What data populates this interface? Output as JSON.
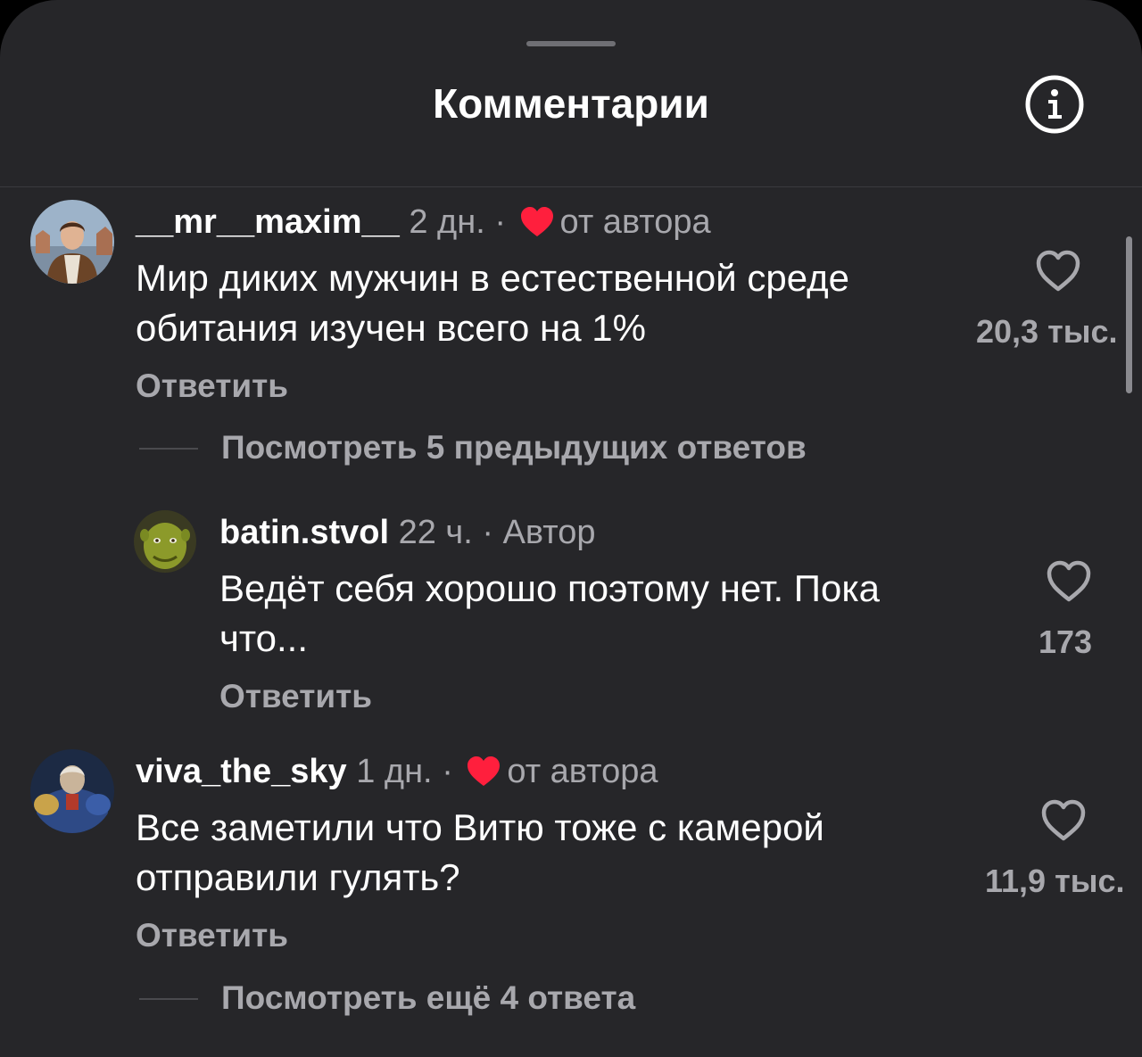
{
  "header": {
    "title": "Комментарии"
  },
  "colors": {
    "background": "#262629",
    "text": "#ffffff",
    "secondary": "#a8a8ad",
    "heart_red": "#ff1f3d"
  },
  "comments": [
    {
      "username": "__mr__maxim__",
      "time": "2 дн.",
      "separator": "·",
      "badge": "от автора",
      "badge_icon": "red-heart-icon",
      "text_lines": [
        "Мир диких мужчин в естественной среде",
        "обитания изучен всего на 1%"
      ],
      "reply_label": "Ответить",
      "likes": "20,3 тыс.",
      "view_replies": "Посмотреть 5 предыдущих ответов"
    },
    {
      "username": "batin.stvol",
      "time": "22 ч.",
      "separator": "·",
      "badge": "Автор",
      "text_lines": [
        "Ведёт себя хорошо поэтому нет. Пока",
        "что..."
      ],
      "reply_label": "Ответить",
      "likes": "173"
    },
    {
      "username": "viva_the_sky",
      "time": "1 дн.",
      "separator": "·",
      "badge": "от автора",
      "badge_icon": "red-heart-icon",
      "text_lines": [
        "Все заметили что Витю тоже с камерой",
        "отправили гулять?"
      ],
      "reply_label": "Ответить",
      "likes": "11,9 тыс.",
      "view_replies": "Посмотреть ещё 4 ответа"
    }
  ]
}
